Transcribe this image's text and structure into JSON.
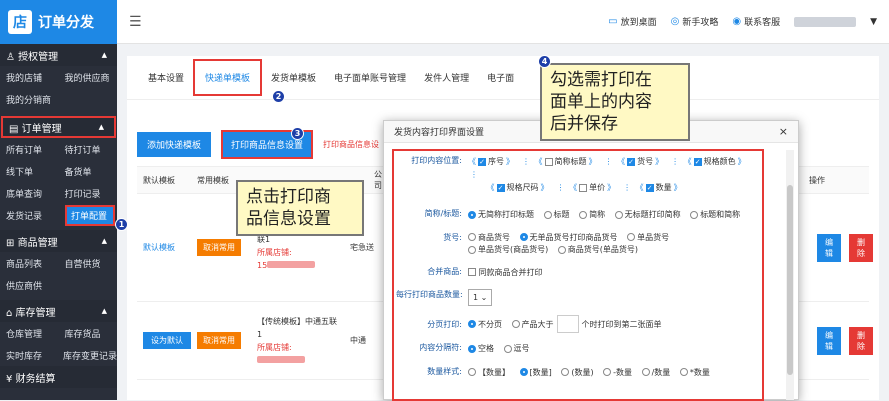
{
  "brand": {
    "logo": "店",
    "name": "订单分发"
  },
  "sidebar": {
    "sections": [
      {
        "title": "授权管理",
        "rows": [
          [
            "我的店铺",
            "我的供应商"
          ],
          [
            "我的分销商",
            ""
          ]
        ]
      },
      {
        "title": "订单管理",
        "rows": [
          [
            "所有订单",
            "待打订单"
          ],
          [
            "线下单",
            "备货单"
          ],
          [
            "底单查询",
            "打印记录"
          ],
          [
            "发货记录",
            "打单配置"
          ]
        ]
      },
      {
        "title": "商品管理",
        "rows": [
          [
            "商品列表",
            "自营供货"
          ],
          [
            "供应商供",
            ""
          ]
        ]
      },
      {
        "title": "库存管理",
        "rows": [
          [
            "仓库管理",
            "库存货品"
          ],
          [
            "实时库存",
            "库存变更记录"
          ]
        ]
      },
      {
        "title": "财务结算",
        "rows": []
      }
    ]
  },
  "topbar": {
    "menu_icon": "menu-icon",
    "items": [
      "放到桌面",
      "新手攻略",
      "联系客服"
    ]
  },
  "tabs": [
    "基本设置",
    "快递单模板",
    "发货单模板",
    "电子面单账号管理",
    "发件人管理",
    "电子面"
  ],
  "actions": {
    "add_template": "添加快递模板",
    "print_info": "打印商品信息设置",
    "hint": "打印商品信息设"
  },
  "table": {
    "headers": [
      "默认模板",
      "常用模板",
      "",
      "",
      "操作"
    ],
    "rows": [
      {
        "default": "默认模板",
        "common": "取消常用",
        "tpl_line": "联1",
        "shop_label": "所属店铺:",
        "shop_val": "15",
        "carrier": "宅急送",
        "edit": "编辑",
        "del": "删除"
      },
      {
        "default": "设为默认",
        "common": "取消常用",
        "tpl_line": "【传统模板】中通五联1",
        "shop_label": "所属店铺:",
        "shop_val": "",
        "carrier": "中通",
        "edit": "编辑",
        "del": "删除"
      }
    ],
    "company_fragment": "公司"
  },
  "modal": {
    "title": "发货内容打印界面设置",
    "close": "×",
    "print_pos_label": "打印内容位置:",
    "print_items": [
      {
        "label": "序号",
        "checked": true
      },
      {
        "label": "简称标题",
        "checked": false
      },
      {
        "label": "货号",
        "checked": true
      },
      {
        "label": "规格颜色",
        "checked": true
      },
      {
        "label": "规格尺码",
        "checked": true
      },
      {
        "label": "单价",
        "checked": false
      },
      {
        "label": "数量",
        "checked": true
      }
    ],
    "title_label": "简称/标题:",
    "title_opts": [
      "无简称打印标题",
      "标题",
      "简称",
      "无标题打印简称",
      "标题和简称"
    ],
    "sku_label": "货号:",
    "sku_opts": [
      "商品货号",
      "无单品货号打印商品货号",
      "单品货号",
      "单品货号(商品货号)",
      "商品货号(单品货号)"
    ],
    "merge_label": "合并商品:",
    "merge_opt": "同款商品合并打印",
    "perrow_label": "每行打印商品数量:",
    "perrow_val": "1",
    "paging_label": "分页打印:",
    "paging_opt1": "不分页",
    "paging_opt2": "产品大于",
    "paging_opt3": "个时打印到第二张面单",
    "sep_label": "内容分隔符:",
    "sep_opts": [
      "空格",
      "逗号"
    ],
    "qty_label": "数量样式:",
    "qty_opts": [
      "【数量】",
      "[数量]",
      "(数量)",
      "-数量",
      "/数量",
      "*数量"
    ]
  },
  "callouts": {
    "c1": "点击打印商品信息设置",
    "c1_l1": "点击打印商",
    "c1_l2": "品信息设置",
    "c2_l1": "勾选需打印在",
    "c2_l2": "面单上的内容",
    "c2_l3": "后并保存"
  },
  "badges": [
    "1",
    "2",
    "3",
    "4"
  ]
}
